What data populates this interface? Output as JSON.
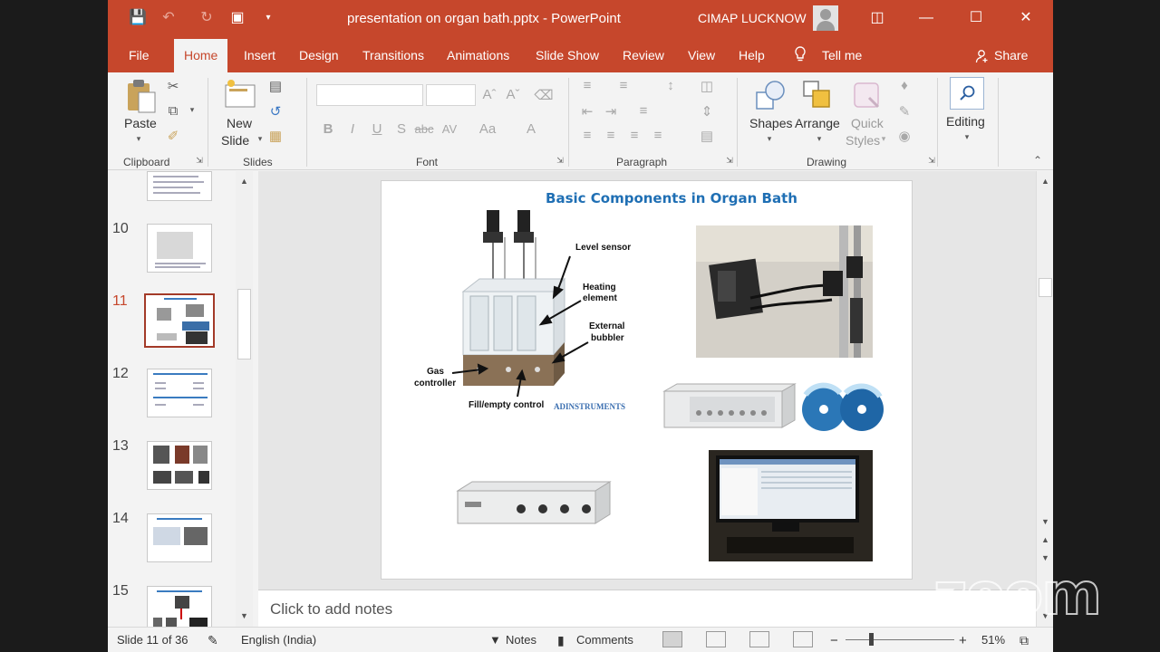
{
  "window": {
    "title": "presentation on organ bath.pptx  -  PowerPoint",
    "user": "CIMAP LUCKNOW",
    "accent": "#c6472c"
  },
  "quick_access": [
    "save-icon",
    "undo-icon",
    "redo-icon",
    "present-from-start-icon",
    "customize-icon"
  ],
  "tabs": [
    {
      "label": "File"
    },
    {
      "label": "Home"
    },
    {
      "label": "Insert"
    },
    {
      "label": "Design"
    },
    {
      "label": "Transitions"
    },
    {
      "label": "Animations"
    },
    {
      "label": "Slide Show"
    },
    {
      "label": "Review"
    },
    {
      "label": "View"
    },
    {
      "label": "Help"
    }
  ],
  "active_tab": "Home",
  "tell_me": "Tell me",
  "share": "Share",
  "ribbon": {
    "clipboard": {
      "label": "Clipboard",
      "paste": "Paste"
    },
    "slides": {
      "label": "Slides",
      "new_slide_1": "New",
      "new_slide_2": "Slide"
    },
    "font": {
      "label": "Font",
      "bold": "B",
      "italic": "I",
      "underline": "U",
      "shadow": "S",
      "strike": "abc",
      "spacing": "AV",
      "case": "Aa",
      "color": "A"
    },
    "paragraph": {
      "label": "Paragraph"
    },
    "drawing": {
      "label": "Drawing",
      "shapes": "Shapes",
      "arrange": "Arrange",
      "quick_1": "Quick",
      "quick_2": "Styles"
    },
    "editing": {
      "label": "Editing"
    }
  },
  "thumbnails": [
    {
      "number": "10"
    },
    {
      "number": "11",
      "selected": true
    },
    {
      "number": "12"
    },
    {
      "number": "13"
    },
    {
      "number": "14"
    },
    {
      "number": "15"
    }
  ],
  "slide": {
    "title": "Basic Components in Organ Bath",
    "labels": {
      "level_sensor": "Level sensor",
      "heating_1": "Heating",
      "heating_2": "element",
      "external_1": "External",
      "external_2": "bubbler",
      "gas_1": "Gas",
      "gas_2": "controller",
      "fill": "Fill/empty control",
      "brand": "ADINSTRUMENTS"
    }
  },
  "notes_placeholder": "Click to add notes",
  "status": {
    "slide_of": "Slide 11 of 36",
    "language": "English (India)",
    "notes": "Notes",
    "comments": "Comments",
    "zoom": "51%"
  },
  "watermark": "zoom"
}
